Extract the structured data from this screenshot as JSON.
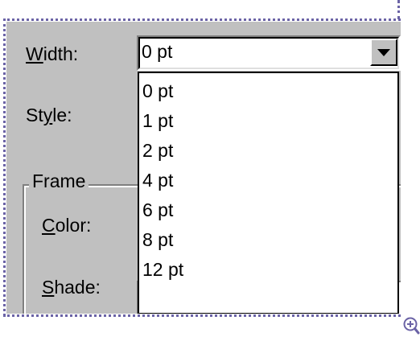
{
  "labels": {
    "width_pre": "",
    "width_u": "W",
    "width_post": "idth:",
    "style_pre": "St",
    "style_u": "y",
    "style_post": "le:",
    "frame": "Frame",
    "color_u": "C",
    "color_post": "olor:",
    "shade_u": "S",
    "shade_post": "hade:"
  },
  "width_combo": {
    "value": "0 pt",
    "options": [
      "0 pt",
      "1 pt",
      "2 pt",
      "4 pt",
      "6 pt",
      "8 pt",
      "12 pt"
    ]
  },
  "colors": {
    "dialog_bg": "#c0c0c0",
    "selection_border": "#6b63a6",
    "zoom_icon": "#6b63a6"
  },
  "icons": {
    "dropdown_arrow": "triangle-down-icon",
    "zoom": "zoom-in-icon"
  }
}
